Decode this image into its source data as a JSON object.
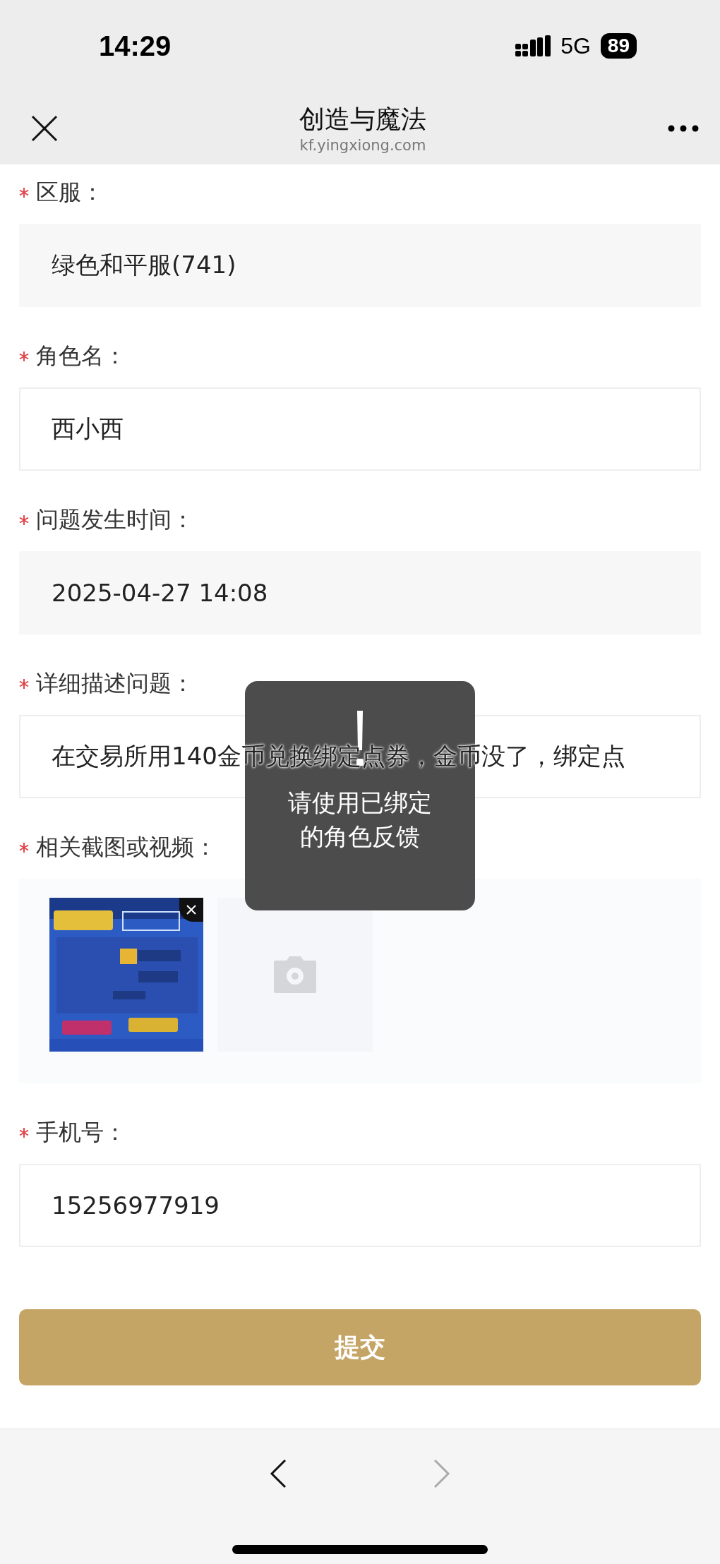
{
  "status_bar": {
    "time": "14:29",
    "network": "5G",
    "battery": "89"
  },
  "nav": {
    "title": "创造与魔法",
    "url": "kf.yingxiong.com"
  },
  "form": [
    {
      "kind": "static_field",
      "label": "区服：",
      "required": true,
      "value": "绿色和平服(741)"
    },
    {
      "kind": "input_field",
      "label": "角色名：",
      "required": true,
      "value": "西小西"
    },
    {
      "kind": "static_field",
      "label": "问题发生时间：",
      "required": true,
      "value": "2025-04-27 14:08"
    },
    {
      "kind": "input_field",
      "label": "详细描述问题：",
      "required": true,
      "value": "在交易所用140金币兑换绑定点券，金币没了，绑定点"
    },
    {
      "kind": "upload",
      "label": "相关截图或视频：",
      "required": true
    },
    {
      "kind": "input_field",
      "label": "手机号：",
      "required": true,
      "value": "15256977919"
    }
  ],
  "submit": {
    "label": "提交"
  },
  "toast": {
    "message": "请使用已绑定的角色反馈"
  },
  "browser_nav": {
    "back": {
      "disabled": false
    },
    "forward": {
      "disabled": true
    }
  }
}
